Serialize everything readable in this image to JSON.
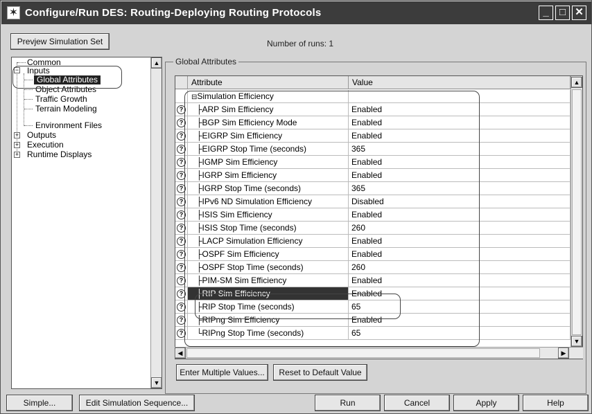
{
  "window": {
    "title": "Configure/Run DES: Routing-Deploying Routing Protocols"
  },
  "toolbar": {
    "preview_label": "Prevjew Simulation Set",
    "runs_text": "Number of runs: 1"
  },
  "tree": {
    "items": [
      {
        "label": "Common"
      },
      {
        "label": "Inputs"
      },
      {
        "label": "Global Attributes"
      },
      {
        "label": "Object Attributes"
      },
      {
        "label": "Traffic Growth"
      },
      {
        "label": "Terrain Modeling"
      },
      {
        "label": "Environment Files"
      },
      {
        "label": "Outputs"
      },
      {
        "label": "Execution"
      },
      {
        "label": "Runtime Displays"
      }
    ]
  },
  "global_attributes": {
    "group_label": "Global Attributes",
    "headers": {
      "attribute": "Attribute",
      "value": "Value"
    },
    "section": "Simulation Efficiency",
    "rows": [
      {
        "attribute": "ARP Sim Efficiency",
        "value": "Enabled"
      },
      {
        "attribute": "BGP Sim Efficiency Mode",
        "value": "Enabled"
      },
      {
        "attribute": "EIGRP Sim Efficiency",
        "value": "Enabled"
      },
      {
        "attribute": "EIGRP Stop Time (seconds)",
        "value": "365"
      },
      {
        "attribute": "IGMP Sim Efficiency",
        "value": "Enabled"
      },
      {
        "attribute": "IGRP Sim Efficiency",
        "value": "Enabled"
      },
      {
        "attribute": "IGRP Stop Time (seconds)",
        "value": "365"
      },
      {
        "attribute": "IPv6 ND Simulation Efficiency",
        "value": "Disabled"
      },
      {
        "attribute": "ISIS Sim Efficiency",
        "value": "Enabled"
      },
      {
        "attribute": "ISIS Stop Time (seconds)",
        "value": "260"
      },
      {
        "attribute": "LACP Simulation Efficiency",
        "value": "Enabled"
      },
      {
        "attribute": "OSPF Sim Efficiency",
        "value": "Enabled"
      },
      {
        "attribute": "OSPF Stop Time (seconds)",
        "value": "260"
      },
      {
        "attribute": "PIM-SM Sim Efficiency",
        "value": "Enabled"
      },
      {
        "attribute": "RIP Sim Efficiency",
        "value": "Enabled"
      },
      {
        "attribute": "RIP Stop Time (seconds)",
        "value": "65"
      },
      {
        "attribute": "RIPng Sim Efficiency",
        "value": "Enabled"
      },
      {
        "attribute": "RIPng Stop Time (seconds)",
        "value": "65"
      }
    ],
    "selected_row": "RIP Sim Efficiency"
  },
  "grid_buttons": {
    "enter_multiple": "Enter Multiple Values...",
    "reset_default": "Reset to Default Value"
  },
  "footer": {
    "simple": "Simple...",
    "edit_sequence": "Edit Simulation Sequence...",
    "run": "Run",
    "cancel": "Cancel",
    "apply": "Apply",
    "help": "Help"
  },
  "icons": {
    "app": "star-icon",
    "row": "question-icon"
  }
}
